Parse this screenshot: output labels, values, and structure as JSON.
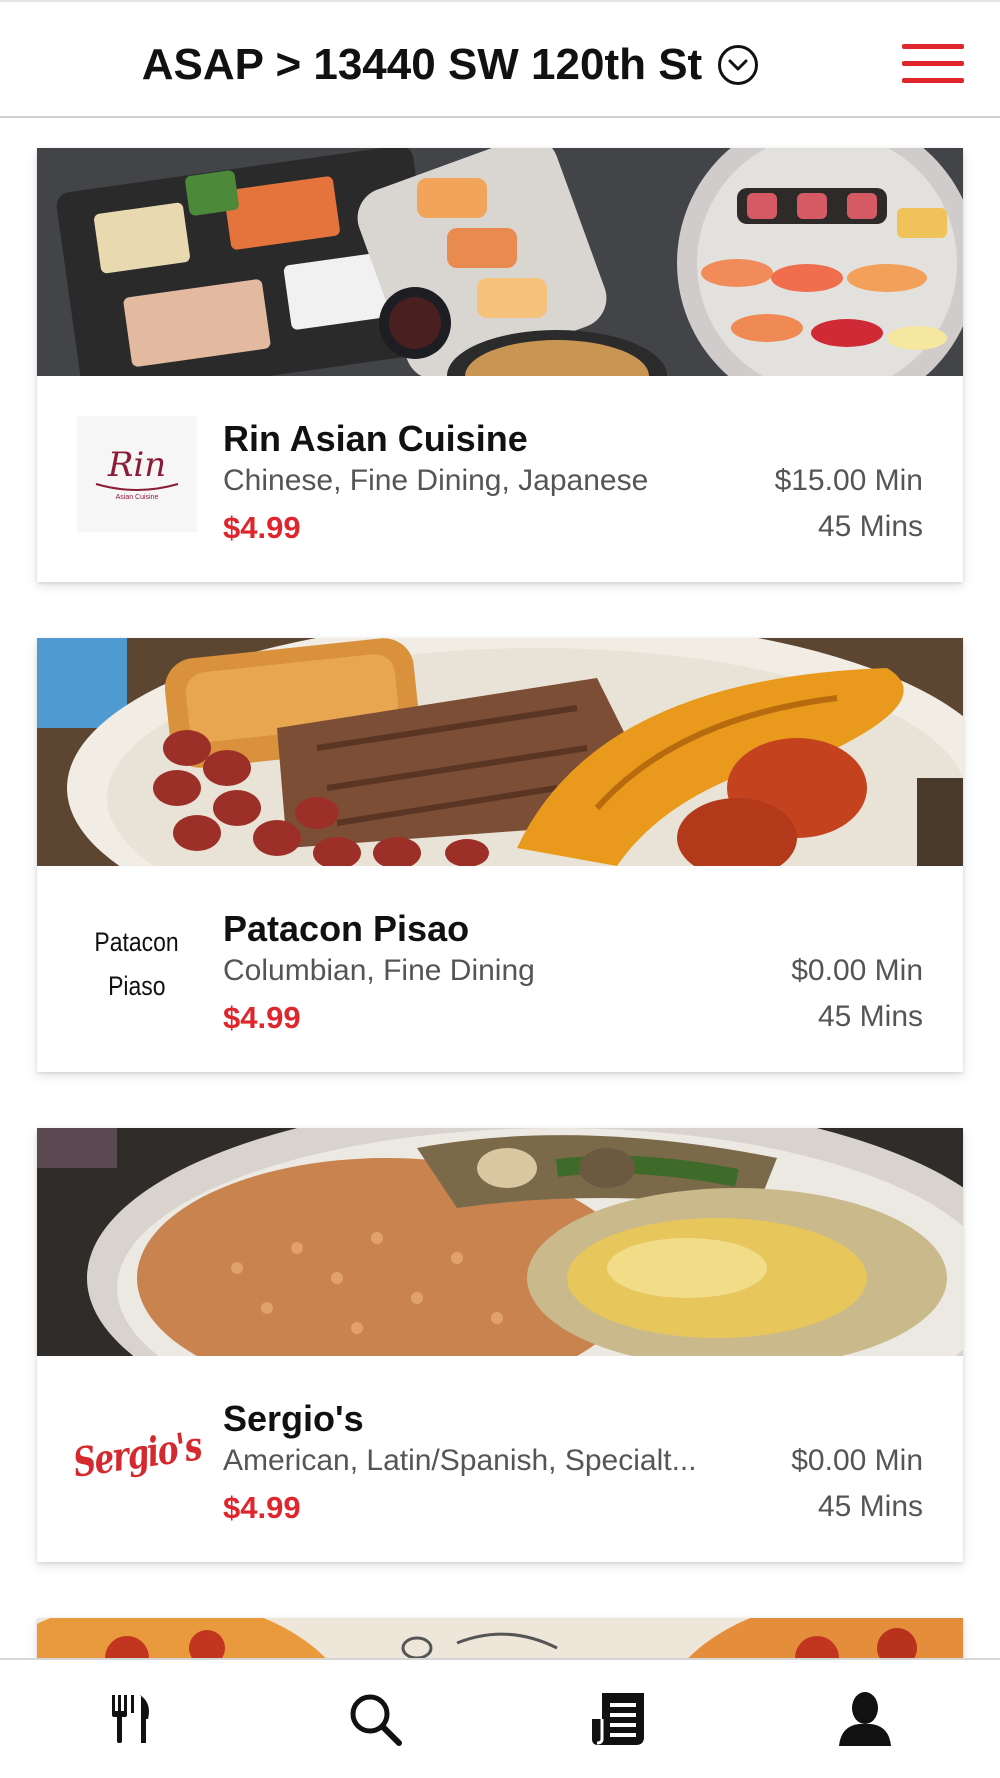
{
  "header": {
    "address": "ASAP > 13440 SW 120th St",
    "dropdown_icon": "chevron-circle-down-icon",
    "menu_icon": "hamburger-menu-icon",
    "accent_color": "#e0262d"
  },
  "restaurants": [
    {
      "name": "Rin Asian Cuisine",
      "cuisine": "Chinese, Fine Dining, Japanese",
      "delivery_fee": "$4.99",
      "min_order": "$15.00 Min",
      "eta": "45 Mins",
      "logo_text": "Rin",
      "logo_subtext": "Asian Cuisine",
      "photo": "sushi and bento platters"
    },
    {
      "name": "Patacon Pisao",
      "cuisine": "Columbian, Fine Dining",
      "delivery_fee": "$4.99",
      "min_order": "$0.00 Min",
      "eta": "45 Mins",
      "logo_text_line1": "Patacon",
      "logo_text_line2": "Piaso",
      "photo": "steak, beans, plantain and sausage plate"
    },
    {
      "name": "Sergio's",
      "cuisine": "American, Latin/Spanish, Specialt...",
      "delivery_fee": "$4.99",
      "min_order": "$0.00 Min",
      "eta": "45 Mins",
      "logo_text": "Sergio's",
      "photo": "rice, beans and fajita plate"
    }
  ],
  "tabbar": {
    "items": [
      {
        "icon": "fork-knife-icon"
      },
      {
        "icon": "search-icon"
      },
      {
        "icon": "orders-icon"
      },
      {
        "icon": "account-icon"
      }
    ]
  }
}
